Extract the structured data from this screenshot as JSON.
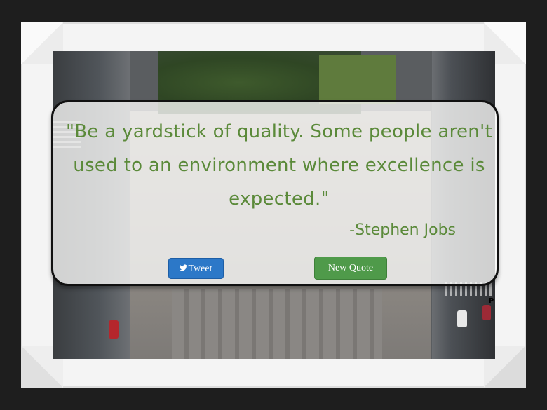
{
  "quote": {
    "text": "\"Be a yardstick of quality. Some people aren't used to an environment where excellence is expected.\"",
    "author": "-Stephen Jobs"
  },
  "buttons": {
    "tweet_label": "Tweet",
    "new_quote_label": "New Quote"
  },
  "icons": {
    "tweet": "twitter-bird-icon"
  },
  "colors": {
    "quote_text": "#5b8a3a",
    "tweet_button": "#2c78c8",
    "new_quote_button": "#4f9a4a",
    "card_border": "#111111",
    "frame": "#1e1e1e",
    "mat": "#f4f4f4"
  }
}
